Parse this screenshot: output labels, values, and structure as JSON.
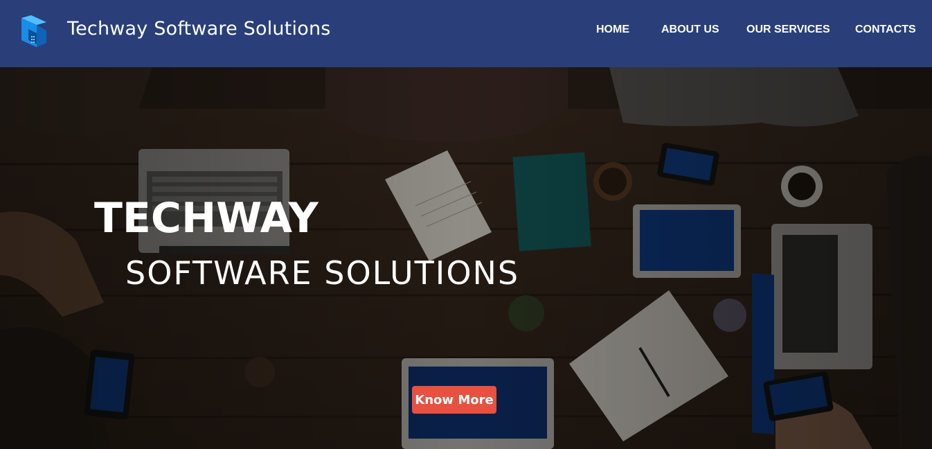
{
  "header": {
    "brand": "Techway Software Solutions",
    "logo_icon": "techway-logo-icon",
    "background": "#2a3f7a"
  },
  "nav": {
    "items": [
      {
        "label": "HOME"
      },
      {
        "label": "ABOUT US"
      },
      {
        "label": "OUR SERVICES"
      },
      {
        "label": "CONTACTS"
      }
    ]
  },
  "hero": {
    "title": "TECHWAY",
    "subtitle": "SOFTWARE SOLUTIONS",
    "cta_label": "Know More",
    "cta_color": "#e8503f",
    "background_description_icon": "office-desk-background"
  }
}
